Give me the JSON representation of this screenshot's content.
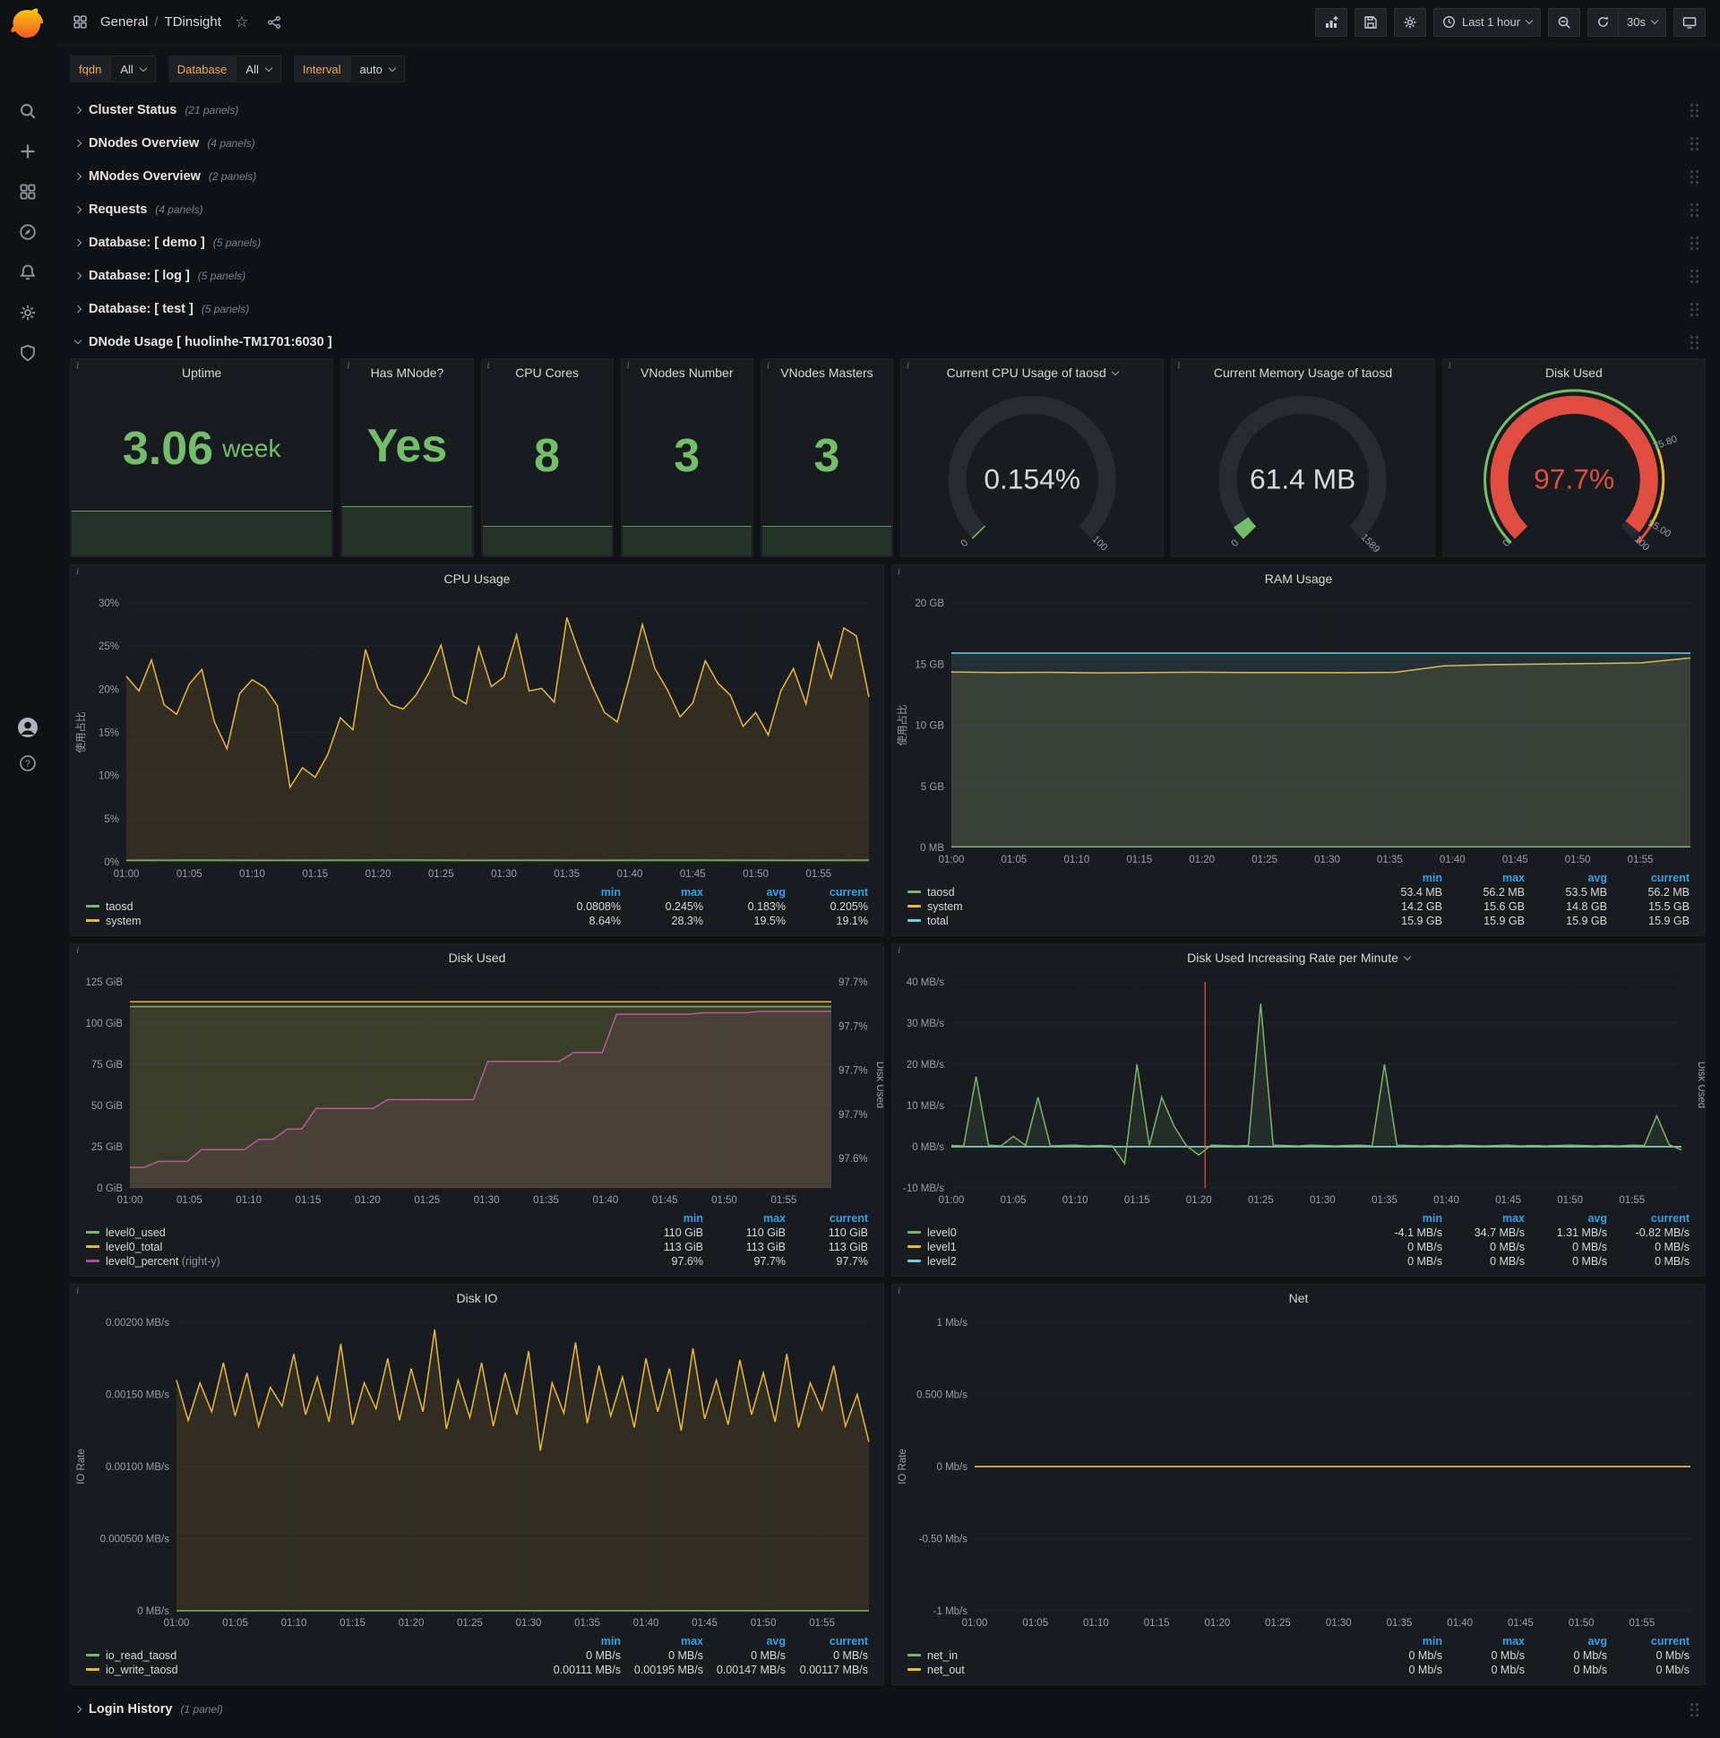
{
  "nav": {
    "breadcrumb": {
      "section": "General",
      "separator": "/",
      "page": "TDinsight"
    },
    "time_range": "Last 1 hour",
    "refresh_interval": "30s"
  },
  "variables": [
    {
      "label": "fqdn",
      "value": "All"
    },
    {
      "label": "Database",
      "value": "All"
    },
    {
      "label": "Interval",
      "value": "auto"
    }
  ],
  "rows": [
    {
      "title": "Cluster Status",
      "count": "(21 panels)"
    },
    {
      "title": "DNodes Overview",
      "count": "(4 panels)"
    },
    {
      "title": "MNodes Overview",
      "count": "(2 panels)"
    },
    {
      "title": "Requests",
      "count": "(4 panels)"
    },
    {
      "title": "Database: [ demo ]",
      "count": "(5 panels)"
    },
    {
      "title": "Database: [ log ]",
      "count": "(5 panels)"
    },
    {
      "title": "Database: [ test ]",
      "count": "(5 panels)"
    }
  ],
  "expanded_row": {
    "title": "DNode Usage [ huolinhe-TM1701:6030 ]"
  },
  "bottom_row": {
    "title": "Login History",
    "count": "(1 panel)"
  },
  "stats": [
    {
      "title": "Uptime",
      "value": "3.06",
      "unit": "week"
    },
    {
      "title": "Has MNode?",
      "value": "Yes",
      "unit": ""
    },
    {
      "title": "CPU Cores",
      "value": "8",
      "unit": ""
    },
    {
      "title": "VNodes Number",
      "value": "3",
      "unit": ""
    },
    {
      "title": "VNodes Masters",
      "value": "3",
      "unit": ""
    }
  ],
  "gauges": {
    "cpu": {
      "title": "Current CPU Usage of taosd",
      "min": 0,
      "max": 100,
      "value": 0.154,
      "text": "0.154%",
      "color": "#73bf69",
      "value_color": "#d8d9da",
      "min_label": "0",
      "max_label": "100"
    },
    "mem": {
      "title": "Current Memory Usage of taosd",
      "min": 0,
      "max": 1589,
      "value": 61.4,
      "text": "61.4 MB",
      "color": "#73bf69",
      "value_color": "#d8d9da",
      "min_label": "0",
      "max_label": "1589"
    },
    "disk": {
      "title": "Disk Used",
      "min": 0,
      "max": 100,
      "value": 97.7,
      "text": "97.7%",
      "color": "#e24d42",
      "value_color": "#e24d42",
      "min_label": "0",
      "max_label": "100",
      "bands": [
        {
          "from": 0,
          "to": 0.758,
          "color": "#73bf69"
        },
        {
          "from": 0.758,
          "to": 0.95,
          "color": "#eab839"
        },
        {
          "from": 0.95,
          "to": 1,
          "color": "#e24d42"
        }
      ],
      "threshold_labels": [
        {
          "f": 0.758,
          "label": "75.80"
        },
        {
          "f": 0.95,
          "label": "95.00"
        }
      ]
    }
  },
  "time_axis": {
    "max": 59,
    "ticks": [
      {
        "m": 0,
        "label": "01:00"
      },
      {
        "m": 5,
        "label": "01:05"
      },
      {
        "m": 10,
        "label": "01:10"
      },
      {
        "m": 15,
        "label": "01:15"
      },
      {
        "m": 20,
        "label": "01:20"
      },
      {
        "m": 25,
        "label": "01:25"
      },
      {
        "m": 30,
        "label": "01:30"
      },
      {
        "m": 35,
        "label": "01:35"
      },
      {
        "m": 40,
        "label": "01:40"
      },
      {
        "m": 45,
        "label": "01:45"
      },
      {
        "m": 50,
        "label": "01:50"
      },
      {
        "m": 55,
        "label": "01:55"
      }
    ]
  },
  "charts": {
    "cpu": {
      "type": "line",
      "title": "CPU Usage",
      "pad_left": 62,
      "pad_right": 16,
      "y_min": 0,
      "y_max": 30,
      "y_title": "使用占比",
      "y_ticks": [
        {
          "v": 0,
          "label": "0%"
        },
        {
          "v": 5,
          "label": "5%"
        },
        {
          "v": 10,
          "label": "10%"
        },
        {
          "v": 15,
          "label": "15%"
        },
        {
          "v": 20,
          "label": "20%"
        },
        {
          "v": 25,
          "label": "25%"
        },
        {
          "v": 30,
          "label": "30%"
        }
      ],
      "series": [
        {
          "name": "system",
          "color": "#eab839",
          "values": [
            21.5,
            19.8,
            23.4,
            18.2,
            17.1,
            20.6,
            22.3,
            16.2,
            13.1,
            19.5,
            21.1,
            20.2,
            18.1,
            8.64,
            10.9,
            9.8,
            12.4,
            16.7,
            15.3,
            24.6,
            20.1,
            18.2,
            17.7,
            19.3,
            21.8,
            25.1,
            19.2,
            18.3,
            24.9,
            20.3,
            21.4,
            26.3,
            19.8,
            20.1,
            18.5,
            28.3,
            24.1,
            20.4,
            17.3,
            16.2,
            21.5,
            27.5,
            22.4,
            19.9,
            16.8,
            18.4,
            23.3,
            20.7,
            19.3,
            15.7,
            17.3,
            14.7,
            19.8,
            22.4,
            18.3,
            25.4,
            21.3,
            27.1,
            26.2,
            19.1
          ]
        },
        {
          "name": "taosd",
          "color": "#7eb26d",
          "values": [
            0.19,
            0.21,
            0.18,
            0.2,
            0.22,
            0.19,
            0.2,
            0.18,
            0.21,
            0.2,
            0.19,
            0.205
          ]
        }
      ],
      "legend": {
        "cols": [
          "min",
          "max",
          "avg",
          "current"
        ],
        "rows": [
          {
            "name": "taosd",
            "color": "#7eb26d",
            "values": [
              "0.0808%",
              "0.245%",
              "0.183%",
              "0.205%"
            ]
          },
          {
            "name": "system",
            "color": "#eab839",
            "values": [
              "8.64%",
              "28.3%",
              "19.5%",
              "19.1%"
            ]
          }
        ]
      }
    },
    "ram": {
      "type": "line",
      "title": "RAM Usage",
      "pad_left": 66,
      "pad_right": 16,
      "y_min": 0,
      "y_max": 20,
      "y_title": "使用占比",
      "y_ticks": [
        {
          "v": 0,
          "label": "0 MB"
        },
        {
          "v": 5,
          "label": "5 GB"
        },
        {
          "v": 10,
          "label": "10 GB"
        },
        {
          "v": 15,
          "label": "15 GB"
        },
        {
          "v": 20,
          "label": "20 GB"
        }
      ],
      "series": [
        {
          "name": "system",
          "color": "#eab839",
          "values": [
            14.35,
            14.3,
            14.32,
            14.28,
            14.3,
            14.33,
            14.3,
            14.31,
            14.29,
            14.32,
            14.85,
            14.95,
            15.0,
            15.05,
            15.1,
            15.5
          ]
        },
        {
          "name": "total",
          "color": "#6ed0e0",
          "values": [
            15.9,
            15.9,
            15.9,
            15.9,
            15.9,
            15.9,
            15.9,
            15.9
          ]
        },
        {
          "name": "taosd",
          "color": "#7eb26d",
          "values": [
            0.053,
            0.054,
            0.053,
            0.053,
            0.054,
            0.056
          ]
        }
      ],
      "legend": {
        "cols": [
          "min",
          "max",
          "avg",
          "current"
        ],
        "rows": [
          {
            "name": "taosd",
            "color": "#7eb26d",
            "values": [
              "53.4 MB",
              "56.2 MB",
              "53.5 MB",
              "56.2 MB"
            ]
          },
          {
            "name": "system",
            "color": "#eab839",
            "values": [
              "14.2 GB",
              "15.6 GB",
              "14.8 GB",
              "15.5 GB"
            ]
          },
          {
            "name": "total",
            "color": "#6ed0e0",
            "values": [
              "15.9 GB",
              "15.9 GB",
              "15.9 GB",
              "15.9 GB"
            ]
          }
        ]
      }
    },
    "disk": {
      "type": "line",
      "title": "Disk Used",
      "pad_left": 66,
      "pad_right": 58,
      "y_min": 0,
      "y_max": 125,
      "right_min": 97.58,
      "right_max": 97.72,
      "right_title": "Disk Used",
      "y_ticks": [
        {
          "v": 0,
          "label": "0 GiB"
        },
        {
          "v": 25,
          "label": "25 GiB"
        },
        {
          "v": 50,
          "label": "50 GiB"
        },
        {
          "v": 75,
          "label": "75 GiB"
        },
        {
          "v": 100,
          "label": "100 GiB"
        },
        {
          "v": 125,
          "label": "125 GiB"
        }
      ],
      "right_ticks": [
        {
          "v": 97.6,
          "label": "97.6%"
        },
        {
          "v": 97.63,
          "label": "97.7%"
        },
        {
          "v": 97.66,
          "label": "97.7%"
        },
        {
          "v": 97.69,
          "label": "97.7%"
        },
        {
          "v": 97.72,
          "label": "97.7%"
        }
      ],
      "series": [
        {
          "name": "level0_percent",
          "color": "#ba43a9",
          "axis": "right",
          "values": [
            97.594,
            97.594,
            97.598,
            97.598,
            97.598,
            97.606,
            97.606,
            97.606,
            97.606,
            97.613,
            97.613,
            97.62,
            97.62,
            97.634,
            97.634,
            97.634,
            97.634,
            97.634,
            97.64,
            97.64,
            97.64,
            97.64,
            97.64,
            97.64,
            97.64,
            97.666,
            97.666,
            97.666,
            97.666,
            97.666,
            97.666,
            97.672,
            97.672,
            97.672,
            97.698,
            97.698,
            97.698,
            97.698,
            97.698,
            97.698,
            97.699,
            97.699,
            97.699,
            97.699,
            97.7,
            97.7,
            97.7,
            97.7,
            97.7,
            97.7
          ]
        },
        {
          "name": "level0_total",
          "color": "#eab839",
          "values": [
            113,
            113,
            113,
            113
          ]
        },
        {
          "name": "level0_used",
          "color": "#7eb26d",
          "values": [
            110,
            110,
            110,
            110
          ]
        }
      ],
      "legend": {
        "cols": [
          "min",
          "max",
          "current"
        ],
        "rows": [
          {
            "name": "level0_used",
            "color": "#7eb26d",
            "values": [
              "110 GiB",
              "110 GiB",
              "110 GiB"
            ]
          },
          {
            "name": "level0_total",
            "color": "#eab839",
            "values": [
              "113 GiB",
              "113 GiB",
              "113 GiB"
            ]
          },
          {
            "name": "level0_percent",
            "color": "#ba43a9",
            "note": "(right-y)",
            "values": [
              "97.6%",
              "97.7%",
              "97.7%"
            ]
          }
        ]
      }
    },
    "rate": {
      "type": "line",
      "title": "Disk Used Increasing Rate per Minute",
      "pad_left": 66,
      "pad_right": 26,
      "y_min": -10,
      "y_max": 40,
      "right_title": "Disk Used",
      "y_ticks": [
        {
          "v": -10,
          "label": "-10 MB/s"
        },
        {
          "v": 0,
          "label": "0 MB/s"
        },
        {
          "v": 10,
          "label": "10 MB/s"
        },
        {
          "v": 20,
          "label": "20 MB/s"
        },
        {
          "v": 30,
          "label": "30 MB/s"
        },
        {
          "v": 40,
          "label": "40 MB/s"
        }
      ],
      "annotations": [
        {
          "x": 20.5,
          "color": "#e24d42"
        }
      ],
      "series": [
        {
          "name": "level1",
          "color": "#eab839",
          "values": [
            0,
            0,
            0,
            0
          ]
        },
        {
          "name": "level2",
          "color": "#6ed0e0",
          "values": [
            0,
            0,
            0,
            0
          ]
        },
        {
          "name": "level0",
          "color": "#7eb26d",
          "values": [
            0.3,
            0.2,
            17,
            0.4,
            0.2,
            2.5,
            0.3,
            12,
            0.2,
            0.3,
            0.4,
            0.2,
            0.3,
            0.2,
            -4.1,
            20,
            0.3,
            12,
            5,
            0.2,
            -2,
            0.4,
            0.3,
            0.2,
            0.3,
            34.7,
            0.4,
            0.3,
            0.2,
            0.4,
            0.3,
            0.2,
            0.3,
            0.4,
            0.2,
            20,
            0.4,
            0.3,
            0.2,
            0.3,
            0.2,
            0.4,
            0.3,
            0.2,
            0.3,
            0.4,
            0.2,
            0.3,
            0.2,
            0.3,
            0.4,
            0.3,
            0.2,
            0.3,
            0.2,
            0.4,
            0.3,
            7.5,
            0.5,
            -0.8
          ]
        }
      ],
      "legend": {
        "cols": [
          "min",
          "max",
          "avg",
          "current"
        ],
        "rows": [
          {
            "name": "level0",
            "color": "#7eb26d",
            "values": [
              "-4.1 MB/s",
              "34.7 MB/s",
              "1.31 MB/s",
              "-0.82 MB/s"
            ]
          },
          {
            "name": "level1",
            "color": "#eab839",
            "values": [
              "0 MB/s",
              "0 MB/s",
              "0 MB/s",
              "0 MB/s"
            ]
          },
          {
            "name": "level2",
            "color": "#6ed0e0",
            "values": [
              "0 MB/s",
              "0 MB/s",
              "0 MB/s",
              "0 MB/s"
            ]
          }
        ]
      }
    },
    "io": {
      "type": "line",
      "title": "Disk IO",
      "pad_left": 118,
      "pad_right": 16,
      "y_min": 0,
      "y_max": 0.002,
      "y_title": "IO Rate",
      "y_ticks": [
        {
          "v": 0,
          "label": "0 MB/s"
        },
        {
          "v": 0.0005,
          "label": "0.000500 MB/s"
        },
        {
          "v": 0.001,
          "label": "0.00100 MB/s"
        },
        {
          "v": 0.0015,
          "label": "0.00150 MB/s"
        },
        {
          "v": 0.002,
          "label": "0.00200 MB/s"
        }
      ],
      "series": [
        {
          "name": "io_read_taosd",
          "color": "#7eb26d",
          "values": [
            0,
            0,
            0,
            0
          ]
        },
        {
          "name": "io_write_taosd",
          "color": "#eab839",
          "values": [
            0.0016,
            0.00132,
            0.00158,
            0.00138,
            0.00172,
            0.00135,
            0.00165,
            0.00128,
            0.00155,
            0.00142,
            0.00178,
            0.00136,
            0.00162,
            0.00131,
            0.00185,
            0.00129,
            0.00158,
            0.0014,
            0.00175,
            0.00132,
            0.00168,
            0.00138,
            0.00195,
            0.00126,
            0.0016,
            0.00134,
            0.00172,
            0.00128,
            0.00165,
            0.00136,
            0.0018,
            0.00111,
            0.00158,
            0.00137,
            0.00186,
            0.0013,
            0.0017,
            0.00135,
            0.00162,
            0.00127,
            0.00175,
            0.00138,
            0.00168,
            0.00125,
            0.00182,
            0.00133,
            0.0016,
            0.00129,
            0.00174,
            0.00136,
            0.00165,
            0.00131,
            0.00178,
            0.00127,
            0.00158,
            0.00139,
            0.0017,
            0.00128,
            0.0015,
            0.00117
          ]
        }
      ],
      "legend": {
        "cols": [
          "min",
          "max",
          "avg",
          "current"
        ],
        "rows": [
          {
            "name": "io_read_taosd",
            "color": "#7eb26d",
            "values": [
              "0 MB/s",
              "0 MB/s",
              "0 MB/s",
              "0 MB/s"
            ]
          },
          {
            "name": "io_write_taosd",
            "color": "#eab839",
            "values": [
              "0.00111 MB/s",
              "0.00195 MB/s",
              "0.00147 MB/s",
              "0.00117 MB/s"
            ]
          }
        ]
      }
    },
    "net": {
      "type": "line",
      "title": "Net",
      "pad_left": 92,
      "pad_right": 16,
      "y_min": -1,
      "y_max": 1,
      "y_title": "IO Rate",
      "y_ticks": [
        {
          "v": -1,
          "label": "-1 Mb/s"
        },
        {
          "v": -0.5,
          "label": "-0.50 Mb/s"
        },
        {
          "v": 0,
          "label": "0 Mb/s"
        },
        {
          "v": 0.5,
          "label": "0.500 Mb/s"
        },
        {
          "v": 1,
          "label": "1 Mb/s"
        }
      ],
      "series": [
        {
          "name": "net_in",
          "color": "#7eb26d",
          "values": [
            0,
            0,
            0,
            0
          ]
        },
        {
          "name": "net_out",
          "color": "#eab839",
          "values": [
            0,
            0,
            0,
            0
          ]
        }
      ],
      "legend": {
        "cols": [
          "min",
          "max",
          "avg",
          "current"
        ],
        "rows": [
          {
            "name": "net_in",
            "color": "#7eb26d",
            "values": [
              "0 Mb/s",
              "0 Mb/s",
              "0 Mb/s",
              "0 Mb/s"
            ]
          },
          {
            "name": "net_out",
            "color": "#eab839",
            "values": [
              "0 Mb/s",
              "0 Mb/s",
              "0 Mb/s",
              "0 Mb/s"
            ]
          }
        ]
      }
    }
  }
}
